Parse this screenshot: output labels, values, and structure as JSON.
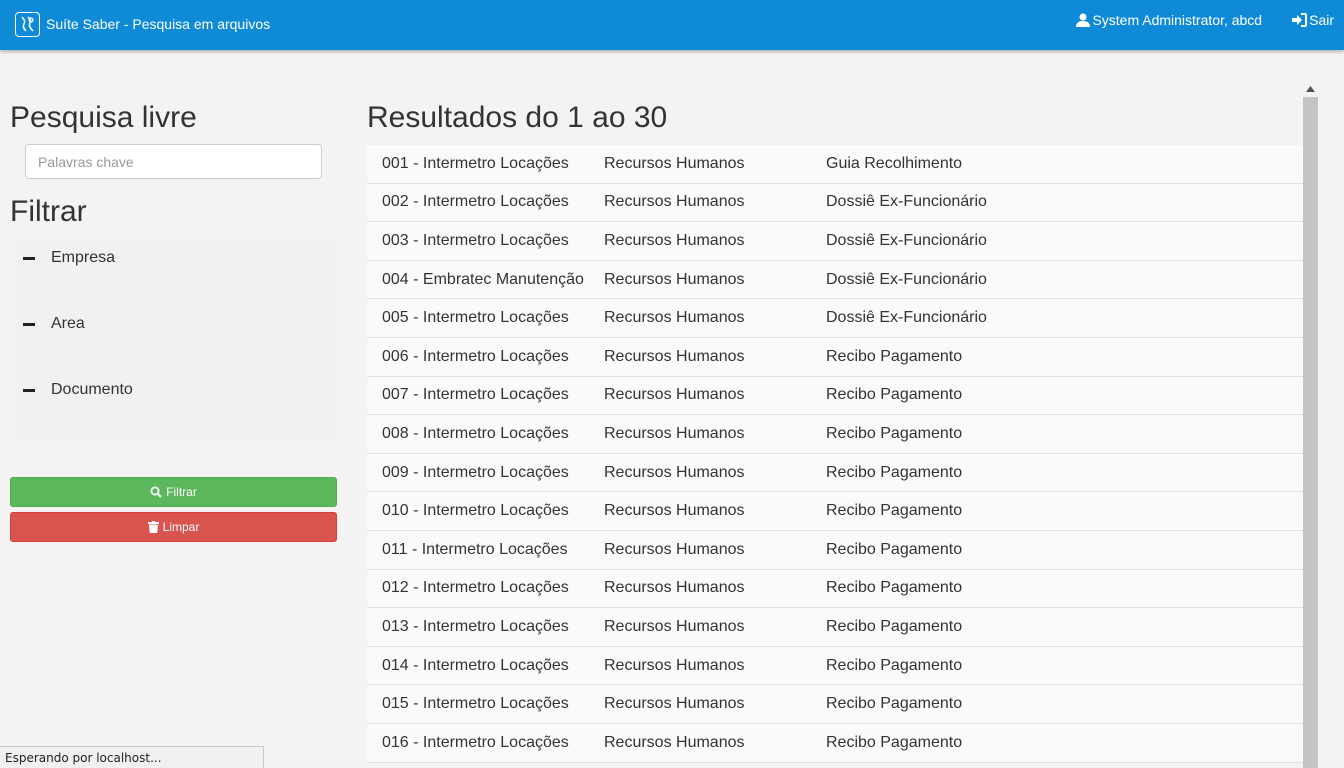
{
  "navbar": {
    "brand": "Suíte Saber - Pesquisa em arquivos",
    "user": "System Administrator, abcd",
    "logout": "Sair",
    "color": "#0f8ad6"
  },
  "sidebar": {
    "search_title": "Pesquisa livre",
    "search_placeholder": "Palavras chave",
    "filter_title": "Filtrar",
    "filters": [
      "Empresa",
      "Area",
      "Documento"
    ],
    "filter_button": "Filtrar",
    "clear_button": "Limpar"
  },
  "results": {
    "title": "Resultados do 1 ao 30",
    "rows": [
      [
        "001 - Intermetro Locações",
        "Recursos Humanos",
        "Guia Recolhimento"
      ],
      [
        "002 - Intermetro Locações",
        "Recursos Humanos",
        "Dossiê Ex-Funcionário"
      ],
      [
        "003 - Intermetro Locações",
        "Recursos Humanos",
        "Dossiê Ex-Funcionário"
      ],
      [
        "004 - Embratec Manutenção",
        "Recursos Humanos",
        "Dossiê Ex-Funcionário"
      ],
      [
        "005 - Intermetro Locações",
        "Recursos Humanos",
        "Dossiê Ex-Funcionário"
      ],
      [
        "006 - Intermetro Locações",
        "Recursos Humanos",
        "Recibo Pagamento"
      ],
      [
        "007 - Intermetro Locações",
        "Recursos Humanos",
        "Recibo Pagamento"
      ],
      [
        "008 - Intermetro Locações",
        "Recursos Humanos",
        "Recibo Pagamento"
      ],
      [
        "009 - Intermetro Locações",
        "Recursos Humanos",
        "Recibo Pagamento"
      ],
      [
        "010 - Intermetro Locações",
        "Recursos Humanos",
        "Recibo Pagamento"
      ],
      [
        "011 - Intermetro Locações",
        "Recursos Humanos",
        "Recibo Pagamento"
      ],
      [
        "012 - Intermetro Locações",
        "Recursos Humanos",
        "Recibo Pagamento"
      ],
      [
        "013 - Intermetro Locações",
        "Recursos Humanos",
        "Recibo Pagamento"
      ],
      [
        "014 - Intermetro Locações",
        "Recursos Humanos",
        "Recibo Pagamento"
      ],
      [
        "015 - Intermetro Locações",
        "Recursos Humanos",
        "Recibo Pagamento"
      ],
      [
        "016 - Intermetro Locações",
        "Recursos Humanos",
        "Recibo Pagamento"
      ]
    ]
  },
  "statusbar": {
    "text": "Esperando por localhost..."
  }
}
